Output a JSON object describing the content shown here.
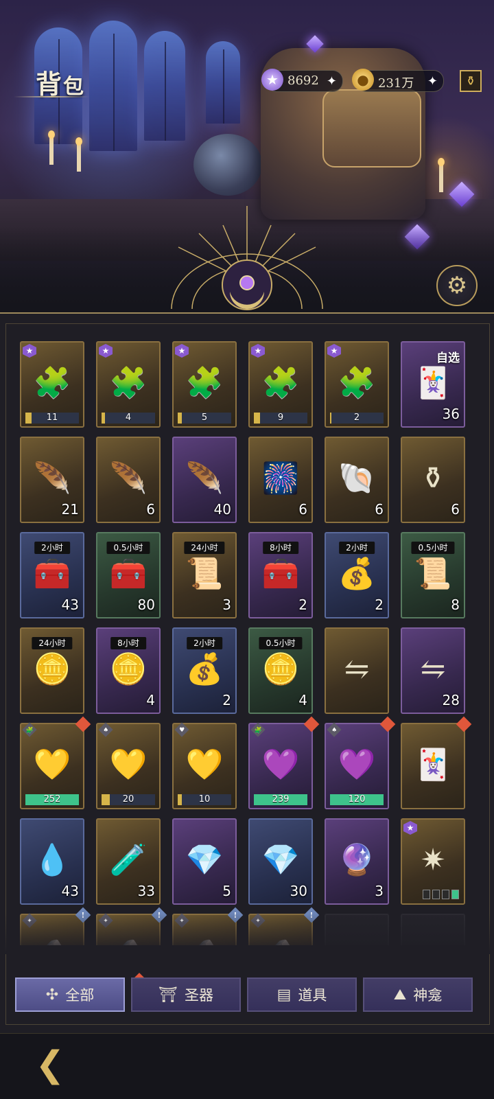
{
  "header": {
    "title_main": "背",
    "title_small": "包"
  },
  "currency": [
    {
      "name": "star-gem",
      "value": "8692"
    },
    {
      "name": "gold-coin",
      "value": "231万"
    }
  ],
  "grid": {
    "rows": [
      [
        {
          "type": "puzzle",
          "color": "gold",
          "icon": "🧩",
          "progress": {
            "text": "11",
            "fill": 0.12,
            "color": "y"
          }
        },
        {
          "type": "puzzle",
          "color": "gold",
          "icon": "🧩",
          "progress": {
            "text": "4",
            "fill": 0.06,
            "color": "y"
          }
        },
        {
          "type": "puzzle",
          "color": "gold",
          "icon": "🧩",
          "progress": {
            "text": "5",
            "fill": 0.08,
            "color": "y"
          }
        },
        {
          "type": "puzzle",
          "color": "gold",
          "icon": "🧩",
          "progress": {
            "text": "9",
            "fill": 0.12,
            "color": "y"
          }
        },
        {
          "type": "puzzle",
          "color": "gold",
          "icon": "🧩",
          "progress": {
            "text": "2",
            "fill": 0.03,
            "color": "y"
          }
        },
        {
          "type": "card",
          "color": "purple",
          "icon": "🃏",
          "label": "自选",
          "qty": "36"
        }
      ],
      [
        {
          "color": "gold",
          "icon": "🪶",
          "qty": "21"
        },
        {
          "color": "gold",
          "icon": "🪶",
          "qty": "6"
        },
        {
          "color": "purple",
          "icon": "🪶",
          "qty": "40"
        },
        {
          "color": "gold",
          "icon": "🎆",
          "qty": "6"
        },
        {
          "color": "gold",
          "icon": "🐚",
          "qty": "6"
        },
        {
          "color": "gold",
          "icon": "⚱",
          "qty": "6"
        }
      ],
      [
        {
          "color": "blue",
          "icon": "🧰",
          "tag": "2小时",
          "qty": "43"
        },
        {
          "color": "green",
          "icon": "🧰",
          "tag": "0.5小时",
          "qty": "80"
        },
        {
          "color": "gold",
          "icon": "📜",
          "tag": "24小时",
          "qty": "3"
        },
        {
          "color": "purple",
          "icon": "🧰",
          "tag": "8小时",
          "qty": "2"
        },
        {
          "color": "blue",
          "icon": "💰",
          "tag": "2小时",
          "qty": "2"
        },
        {
          "color": "green",
          "icon": "📜",
          "tag": "0.5小时",
          "qty": "8"
        }
      ],
      [
        {
          "color": "gold",
          "icon": "🪙",
          "tag": "24小时",
          "qty": ""
        },
        {
          "color": "purple",
          "icon": "🪙",
          "tag": "8小时",
          "qty": "4"
        },
        {
          "color": "blue",
          "icon": "💰",
          "tag": "2小时",
          "qty": "2"
        },
        {
          "color": "green",
          "icon": "🪙",
          "tag": "0.5小时",
          "qty": "4"
        },
        {
          "color": "gold",
          "icon": "⇋",
          "qty": ""
        },
        {
          "color": "purple",
          "icon": "⇋",
          "qty": "28"
        }
      ],
      [
        {
          "color": "gold",
          "icon": "💛",
          "corner": "🧩",
          "badge": "red",
          "progress": {
            "text": "252",
            "fill": 1,
            "color": "g"
          }
        },
        {
          "color": "gold",
          "icon": "💛",
          "corner": "♠",
          "progress": {
            "text": "20",
            "fill": 0.15,
            "color": "y"
          }
        },
        {
          "color": "gold",
          "icon": "💛",
          "corner": "♥",
          "progress": {
            "text": "10",
            "fill": 0.08,
            "color": "y"
          }
        },
        {
          "color": "purple",
          "icon": "💜",
          "corner": "🧩",
          "badge": "red",
          "progress": {
            "text": "239",
            "fill": 1,
            "color": "g"
          }
        },
        {
          "color": "purple",
          "icon": "💜",
          "corner": "♠",
          "badge": "red",
          "progress": {
            "text": "120",
            "fill": 1,
            "color": "g"
          }
        },
        {
          "color": "gold",
          "icon": "🃏",
          "badge": "red",
          "qty": ""
        }
      ],
      [
        {
          "color": "blue",
          "icon": "💧",
          "qty": "43"
        },
        {
          "color": "gold",
          "icon": "🧪",
          "qty": "33"
        },
        {
          "color": "purple",
          "icon": "💎",
          "qty": "5"
        },
        {
          "color": "blue",
          "icon": "💎",
          "qty": "30"
        },
        {
          "color": "purple",
          "icon": "🔮",
          "qty": "3"
        },
        {
          "color": "gold",
          "icon": "✷",
          "star": true,
          "slots": [
            false,
            false,
            false,
            true
          ]
        }
      ],
      [
        {
          "color": "gold",
          "icon": "🪨",
          "corner": "✦",
          "badge": "blue",
          "badge_text": "!"
        },
        {
          "color": "gold",
          "icon": "🪨",
          "corner": "✦",
          "badge": "blue",
          "badge_text": "!"
        },
        {
          "color": "gold",
          "icon": "🪨",
          "corner": "✦",
          "badge": "blue",
          "badge_text": "!"
        },
        {
          "color": "gold",
          "icon": "🪨",
          "corner": "✦",
          "badge": "blue",
          "badge_text": "!"
        },
        {
          "color": "empty"
        },
        {
          "color": "empty"
        }
      ]
    ]
  },
  "tabs": [
    {
      "label": "全部",
      "icon": "✣",
      "active": true
    },
    {
      "label": "圣器",
      "icon": "⛩",
      "active": false
    },
    {
      "label": "道具",
      "icon": "▤",
      "active": false
    },
    {
      "label": "神龛",
      "icon": "⛰",
      "active": false
    }
  ],
  "colors": {
    "accent": "#cfae5c",
    "active_tab": "#5a5a96",
    "progress_green": "#3ec38b",
    "progress_yellow": "#d6b54a",
    "badge_red": "#e0573b"
  }
}
